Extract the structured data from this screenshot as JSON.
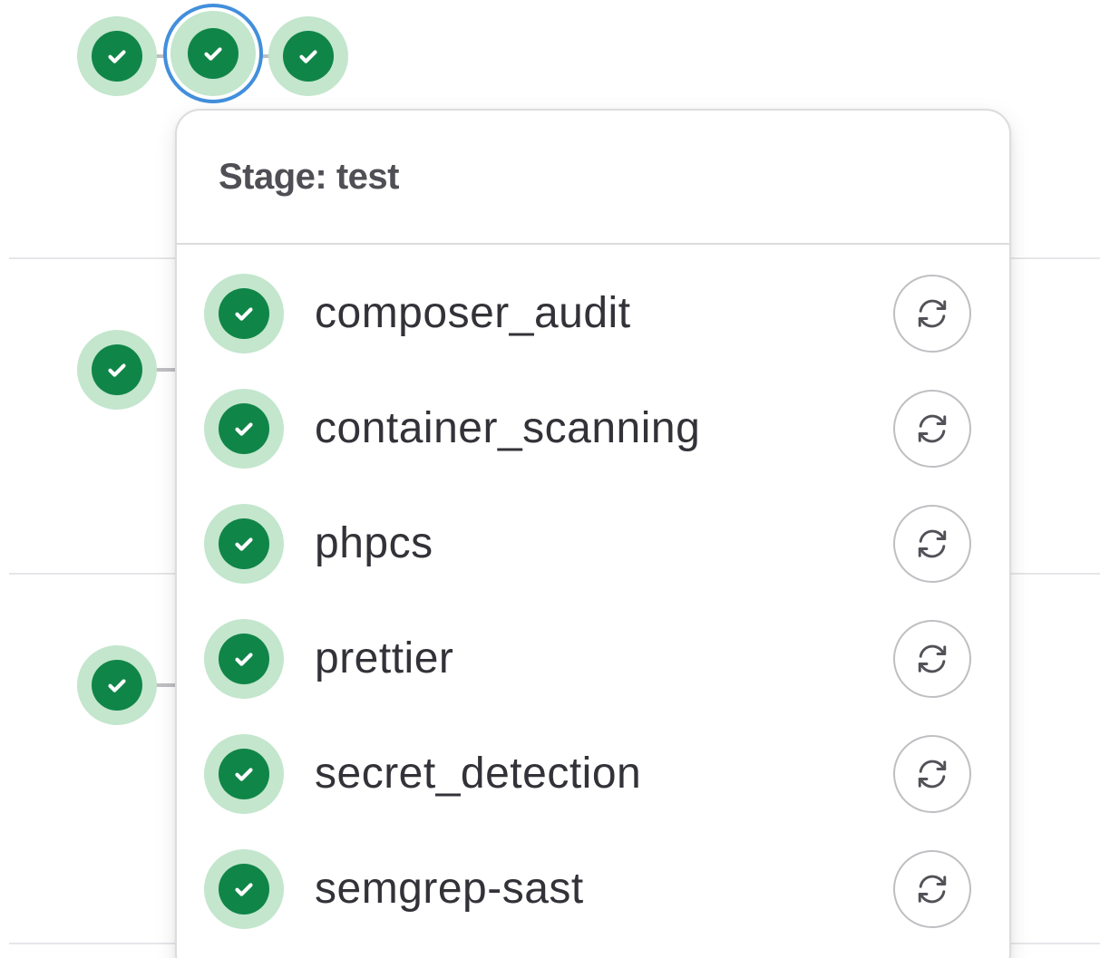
{
  "colors": {
    "success": "#108548",
    "success_ring": "#c3e6cd",
    "focus_ring": "#428fdc"
  },
  "pipeline": {
    "stages": [
      {
        "status_icon": "status-success-icon"
      },
      {
        "status_icon": "status-success-icon"
      },
      {
        "status_icon": "status-success-icon"
      }
    ]
  },
  "dropdown": {
    "title": "Stage: test",
    "jobs": [
      {
        "name": "composer_audit",
        "status_icon": "status-success-icon",
        "action_icon": "retry-icon"
      },
      {
        "name": "container_scanning",
        "status_icon": "status-success-icon",
        "action_icon": "retry-icon"
      },
      {
        "name": "phpcs",
        "status_icon": "status-success-icon",
        "action_icon": "retry-icon"
      },
      {
        "name": "prettier",
        "status_icon": "status-success-icon",
        "action_icon": "retry-icon"
      },
      {
        "name": "secret_detection",
        "status_icon": "status-success-icon",
        "action_icon": "retry-icon"
      },
      {
        "name": "semgrep-sast",
        "status_icon": "status-success-icon",
        "action_icon": "retry-icon"
      }
    ]
  }
}
